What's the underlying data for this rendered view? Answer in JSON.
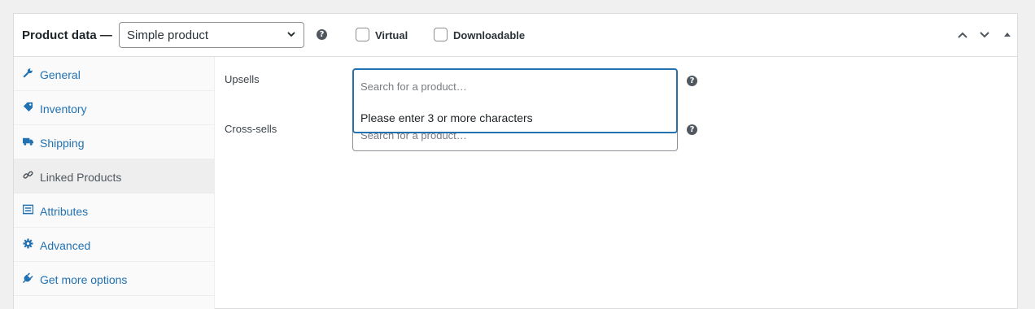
{
  "header": {
    "title": "Product data —",
    "product_type": "Simple product",
    "help_glyph": "?",
    "virtual_label": "Virtual",
    "downloadable_label": "Downloadable",
    "virtual_checked": false,
    "downloadable_checked": false
  },
  "sidebar": {
    "items": [
      {
        "label": "General",
        "icon": "wrench-icon",
        "active": false
      },
      {
        "label": "Inventory",
        "icon": "tag-icon",
        "active": false
      },
      {
        "label": "Shipping",
        "icon": "truck-icon",
        "active": false
      },
      {
        "label": "Linked Products",
        "icon": "link-icon",
        "active": true
      },
      {
        "label": "Attributes",
        "icon": "list-icon",
        "active": false
      },
      {
        "label": "Advanced",
        "icon": "gear-icon",
        "active": false
      },
      {
        "label": "Get more options",
        "icon": "plugin-icon",
        "active": false
      }
    ]
  },
  "fields": {
    "upsells": {
      "label": "Upsells",
      "placeholder": "Search for a product…",
      "dropdown_message": "Please enter 3 or more characters"
    },
    "cross_sells": {
      "label": "Cross-sells",
      "placeholder": "Search for a product…"
    }
  },
  "colors": {
    "link": "#2271b1",
    "focus": "#2271b1",
    "text": "#1d2327"
  }
}
